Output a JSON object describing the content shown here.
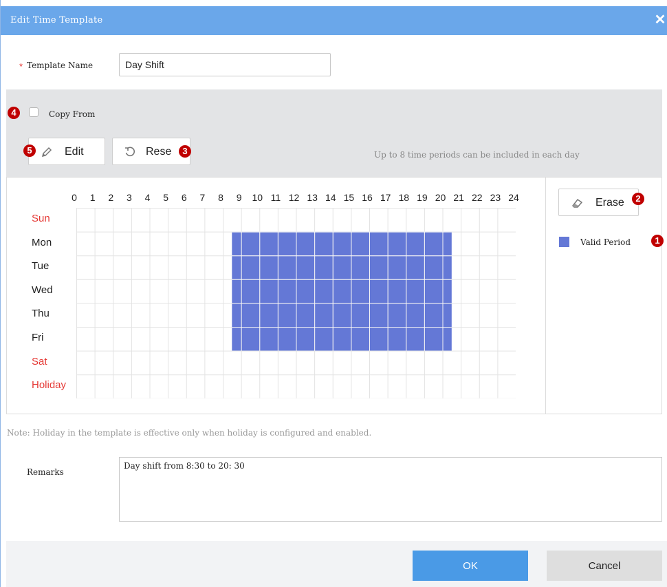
{
  "dialog": {
    "title": "Edit Time Template",
    "close_icon": "close-icon"
  },
  "template_name": {
    "required_mark": "*",
    "label": "Template Name",
    "value": "Day Shift"
  },
  "toolbar": {
    "copy_from_label": "Copy From",
    "copy_from_checked": false,
    "edit_label": "Edit",
    "reset_label": "Rese",
    "hint": "Up to 8 time periods can be included in each day"
  },
  "schedule": {
    "hours": [
      "0",
      "1",
      "2",
      "3",
      "4",
      "5",
      "6",
      "7",
      "8",
      "9",
      "10",
      "11",
      "12",
      "13",
      "14",
      "15",
      "16",
      "17",
      "18",
      "19",
      "20",
      "21",
      "22",
      "23",
      "24"
    ],
    "days": [
      {
        "label": "Sun",
        "color": "#e53935",
        "periods": []
      },
      {
        "label": "Mon",
        "color": "#222222",
        "periods": [
          [
            8.5,
            20.5
          ]
        ]
      },
      {
        "label": "Tue",
        "color": "#222222",
        "periods": [
          [
            8.5,
            20.5
          ]
        ]
      },
      {
        "label": "Wed",
        "color": "#222222",
        "periods": [
          [
            8.5,
            20.5
          ]
        ]
      },
      {
        "label": "Thu",
        "color": "#222222",
        "periods": [
          [
            8.5,
            20.5
          ]
        ]
      },
      {
        "label": "Fri",
        "color": "#222222",
        "periods": [
          [
            8.5,
            20.5
          ]
        ]
      },
      {
        "label": "Sat",
        "color": "#e53935",
        "periods": []
      },
      {
        "label": "Holiday",
        "color": "#e53935",
        "periods": []
      }
    ],
    "period_color": "#6478d6"
  },
  "side": {
    "erase_label": "Erase",
    "legend_label": "Valid Period"
  },
  "note": "Note: Holiday in the template is effective only when holiday is configured and enabled.",
  "remarks": {
    "label": "Remarks",
    "value": "Day shift from 8:30 to 20: 30"
  },
  "footer": {
    "ok_label": "OK",
    "cancel_label": "Cancel"
  },
  "callouts": [
    "1",
    "2",
    "3",
    "4",
    "5"
  ],
  "colors": {
    "titlebar": "#6aa7ea",
    "ok_button": "#4a9ae6",
    "callout": "#c00000"
  }
}
